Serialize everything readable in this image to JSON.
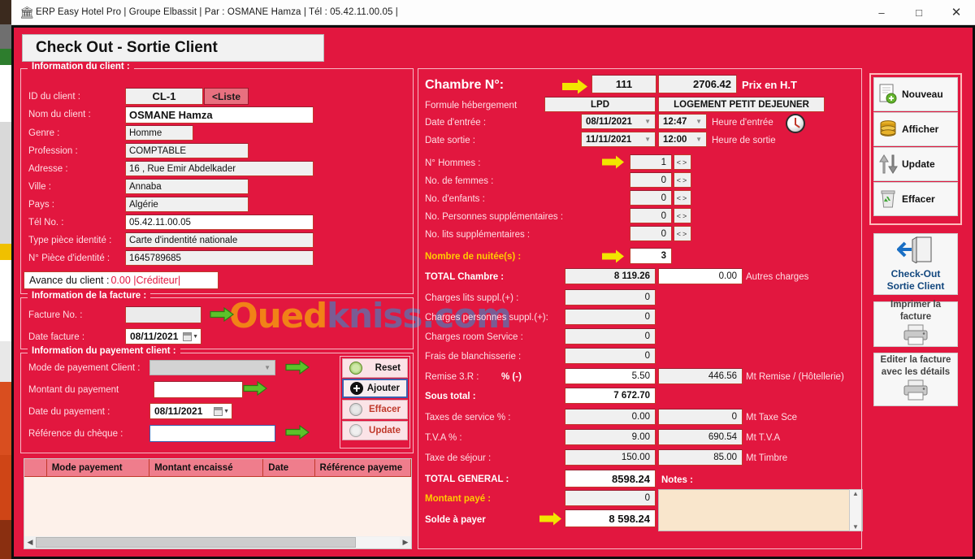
{
  "window": {
    "title": "ERP Easy Hotel Pro | Groupe Elbassit | Par : OSMANE Hamza | Tél : 05.42.11.00.05 |",
    "app_icon": "bank-icon",
    "minimize": "–",
    "maximize": "□",
    "close": "✕"
  },
  "page_title": "Check Out - Sortie Client",
  "watermark": {
    "part1": "Oued",
    "part2": "kniss.com"
  },
  "client": {
    "legend": "Information du client :",
    "fields": [
      {
        "label": "ID du client :",
        "value": "CL-1"
      },
      {
        "label": "Nom du client  :",
        "value": "OSMANE Hamza"
      },
      {
        "label": "Genre :",
        "value": "Homme"
      },
      {
        "label": "Profession :",
        "value": "COMPTABLE"
      },
      {
        "label": "Adresse :",
        "value": "16 , Rue Emir Abdelkader"
      },
      {
        "label": "Ville :",
        "value": "Annaba"
      },
      {
        "label": "Pays :",
        "value": "Algérie"
      },
      {
        "label": "Tél No. :",
        "value": "05.42.11.00.05"
      },
      {
        "label": "Type  pièce identité :",
        "value": "Carte d'indentité nationale"
      },
      {
        "label": "N° Pièce d'identité :",
        "value": "1645789685"
      }
    ],
    "liste_button": "<Liste",
    "avance_label": "Avance du client   :",
    "avance_value": "0.00 |Créditeur|"
  },
  "facture": {
    "legend": "Information de la facture :",
    "numero_label": "Facture No. :",
    "numero_value": "",
    "date_label": "Date facture :",
    "date_value": "08/11/2021"
  },
  "payement": {
    "legend": "Information du payement client  :",
    "mode_label": "Mode de payement Client  :",
    "mode_value": "",
    "montant_label": "Montant du payement",
    "montant_value": "",
    "date_label": "Date du payement :",
    "date_value": "08/11/2021",
    "reference_label": "Référence du chèque :",
    "reference_value": "",
    "buttons": [
      {
        "name": "reset",
        "label": "Reset",
        "icon": "refresh-icon",
        "color": "#111111"
      },
      {
        "name": "ajouter",
        "label": "Ajouter",
        "icon": "plus-circle-icon",
        "color": "#111111"
      },
      {
        "name": "effacer",
        "label": "Effacer",
        "icon": "circle-icon",
        "color": "#c0392b"
      },
      {
        "name": "update",
        "label": "Update",
        "icon": "circle-icon",
        "color": "#c0392b"
      }
    ]
  },
  "payment_table": {
    "columns": [
      "",
      "Mode payement",
      "Montant encaissé",
      "Date",
      "Référence payeme"
    ],
    "rows": []
  },
  "room": {
    "chambre_label": "Chambre N°:",
    "chambre_value": "111",
    "prix_value": "2706.42",
    "prix_label": "Prix en  H.T",
    "formule_label": "Formule hébergement",
    "formule_code": "LPD",
    "formule_desc": "LOGEMENT PETIT DEJEUNER",
    "entree_label": "Date d'entrée :",
    "entree_date": "08/11/2021",
    "entree_heure": "12:47",
    "entree_heure_label": "Heure d'entrée",
    "sortie_label": "Date sortie :",
    "sortie_date": "11/11/2021",
    "sortie_heure": "12:00",
    "sortie_heure_label": "Heure de sortie",
    "clock_icon": "clock-icon",
    "counters": [
      {
        "label": "N° Hommes :",
        "value": "1",
        "highlight": true
      },
      {
        "label": "No. de femmes :",
        "value": "0",
        "highlight": false
      },
      {
        "label": "No. d'enfants :",
        "value": "0",
        "highlight": false
      },
      {
        "label": "No. Personnes supplémentaires :",
        "value": "0",
        "highlight": false
      },
      {
        "label": "No. lits supplémentaires :",
        "value": "0",
        "highlight": false
      }
    ],
    "nuitees_label": "Nombre de nuitée(s) :",
    "nuitees_value": "3"
  },
  "charges": {
    "total_chambre_label": "TOTAL Chambre :",
    "total_chambre_value": "8 119.26",
    "autres_charges_value": "0.00",
    "autres_charges_label": "Autres charges",
    "rows": [
      {
        "label": "Charges lits suppl.(+) :",
        "value": "0"
      },
      {
        "label": "Charges personnes suppl.(+):",
        "value": "0"
      },
      {
        "label": "Charges room Service :",
        "value": "0"
      },
      {
        "label": "Frais de blanchisserie :",
        "value": "0"
      }
    ],
    "remise_label": "Remise 3.R :",
    "remise_pct_label": "% (-)",
    "remise_pct_value": "5.50",
    "remise_mt_value": "446.56",
    "remise_mt_label": "Mt Remise / (Hôtellerie)",
    "sous_total_label": "Sous total :",
    "sous_total_value": "7 672.70",
    "taxe_service_label": "Taxes de service % :",
    "taxe_service_pct": "0.00",
    "taxe_service_mt": "0",
    "taxe_service_mt_label": "Mt Taxe Sce",
    "tva_label": "T.V.A % :",
    "tva_pct": "9.00",
    "tva_mt": "690.54",
    "tva_mt_label": "Mt T.V.A",
    "sejour_label": "Taxe de séjour :",
    "sejour_value": "150.00",
    "timbre_value": "85.00",
    "timbre_label": "Mt Timbre",
    "total_general_label": "TOTAL GENERAL :",
    "total_general_value": "8598.24",
    "montant_paye_label": "Montant payé :",
    "montant_paye_value": "0",
    "solde_label": "Solde à payer",
    "solde_value": "8 598.24",
    "notes_label": "Notes :",
    "notes_value": ""
  },
  "sidebar": {
    "crud": [
      {
        "label": "Nouveau",
        "icon": "new-document-icon"
      },
      {
        "label": "Afficher",
        "icon": "database-icon"
      },
      {
        "label": "Update",
        "icon": "up-down-arrows-icon"
      },
      {
        "label": "Effacer",
        "icon": "trash-icon"
      }
    ],
    "checkout": {
      "line1": "Check-Out",
      "line2": "Sortie Client",
      "icon": "exit-door-icon"
    },
    "print_invoice": {
      "label": "Imprimer la facture",
      "icon": "printer-icon"
    },
    "edit_invoice": {
      "line1": "Editer la facture",
      "line2": "avec les détails",
      "icon": "printer-icon"
    }
  },
  "colors": {
    "background": "#e2173f",
    "accent_yellow": "#f2e500",
    "accent_green": "#5cc22a",
    "field": "#f0f0f0"
  }
}
